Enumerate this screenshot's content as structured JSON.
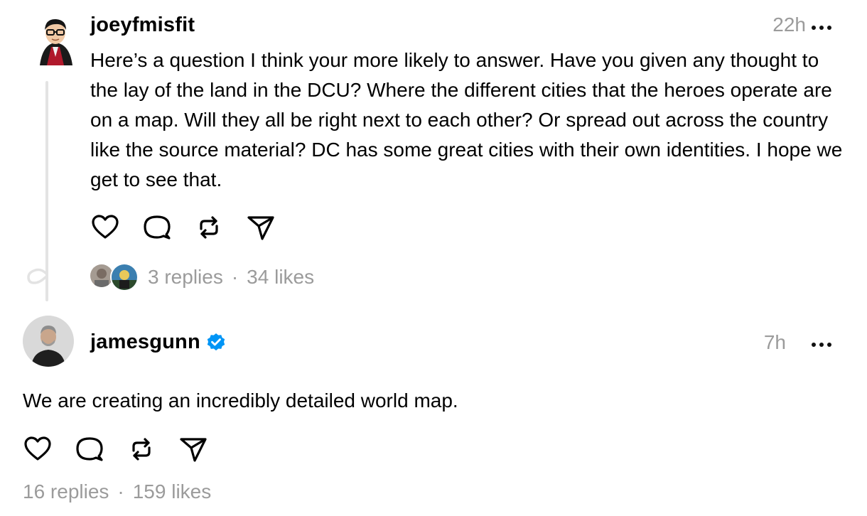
{
  "posts": [
    {
      "username": "joeyfmisfit",
      "time": "22h",
      "text": "Here’s a question I think your more likely to answer. Have you given any thought to the lay of the land in the DCU? Where the different cities that the heroes operate are on a map. Will they all be right next to each other? Or spread out across the country like the source material? DC has some great cities with their own identities. I hope we get to see that.",
      "replies": "3 replies",
      "likes": "34 likes"
    },
    {
      "username": "jamesgunn",
      "verified": true,
      "time": "7h",
      "text": "We are creating an incredibly detailed world map.",
      "replies": "16 replies",
      "likes": "159 likes"
    }
  ],
  "separator": "·",
  "icons": {
    "like": "heart-icon",
    "reply": "speech-bubble-icon",
    "repost": "repost-icon",
    "share": "send-icon",
    "more": "more-horizontal-icon",
    "verified": "verified-badge-icon"
  },
  "colors": {
    "text": "#000000",
    "muted": "#9b9b9b",
    "verified": "#0095f6",
    "thread_line": "#e3e3e3"
  }
}
